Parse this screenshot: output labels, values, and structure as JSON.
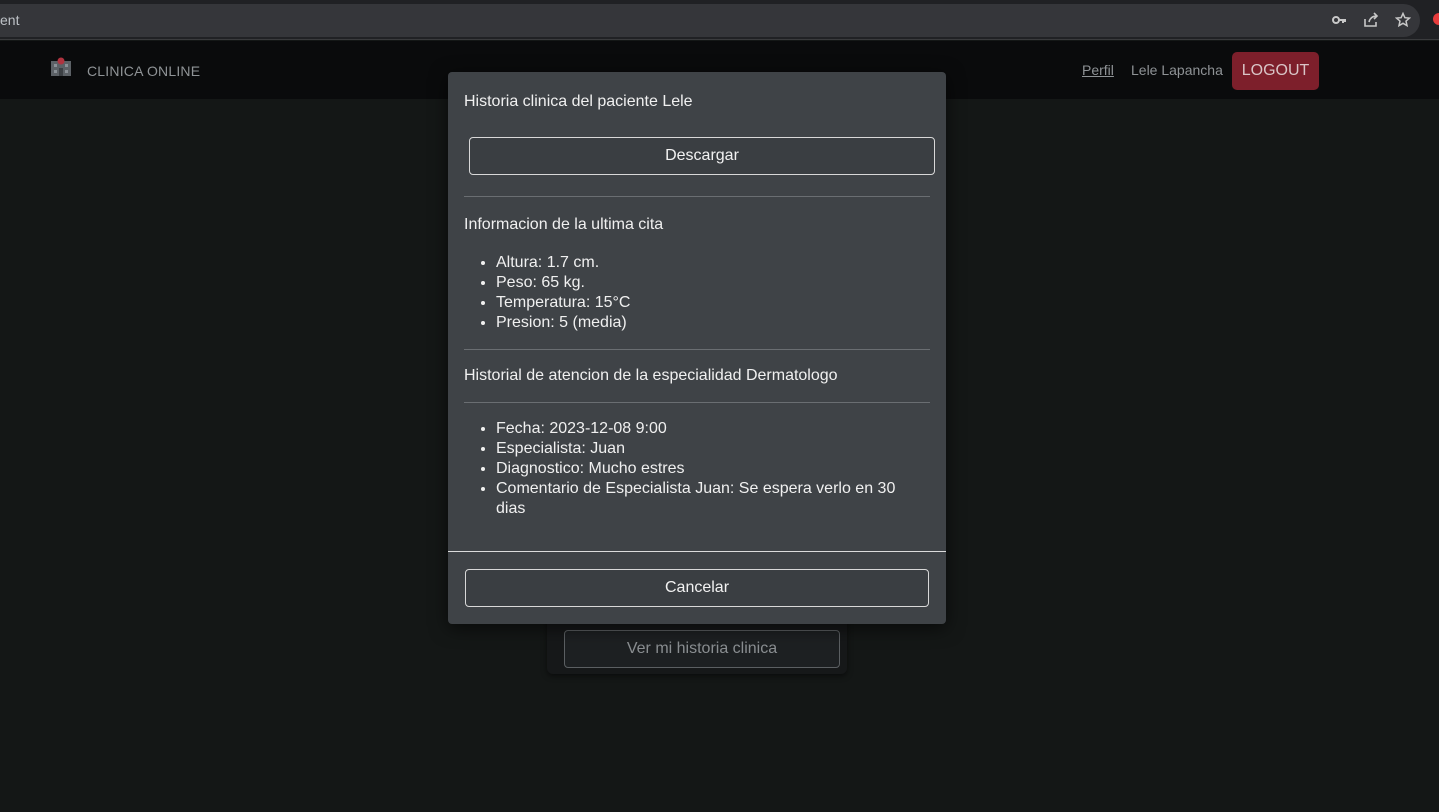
{
  "browser": {
    "address_text": "ent",
    "icons": [
      "key-icon",
      "share-icon",
      "star-icon"
    ]
  },
  "navbar": {
    "brand": "CLINICA ONLINE",
    "perfil_link": "Perfil",
    "user_name": "Lele Lapancha",
    "logout_label": "LOGOUT"
  },
  "background": {
    "ver_historia_label": "Ver mi historia clinica"
  },
  "modal": {
    "title": "Historia clinica del paciente Lele",
    "download_label": "Descargar",
    "last_visit": {
      "heading": "Informacion de la ultima cita",
      "items": [
        "Altura: 1.7 cm.",
        "Peso: 65 kg.",
        "Temperatura: 15°C",
        "Presion: 5 (media)"
      ]
    },
    "specialty_history": {
      "heading": "Historial de atencion de la especialidad Dermatologo",
      "items": [
        "Fecha: 2023-12-08 9:00",
        "Especialista: Juan",
        "Diagnostico: Mucho estres",
        "Comentario de Especialista Juan: Se espera verlo en 30 dias"
      ]
    },
    "cancel_label": "Cancelar"
  },
  "colors": {
    "logout_bg": "#7d1f2b",
    "modal_bg": "#3f4347",
    "page_bg": "#141716"
  }
}
